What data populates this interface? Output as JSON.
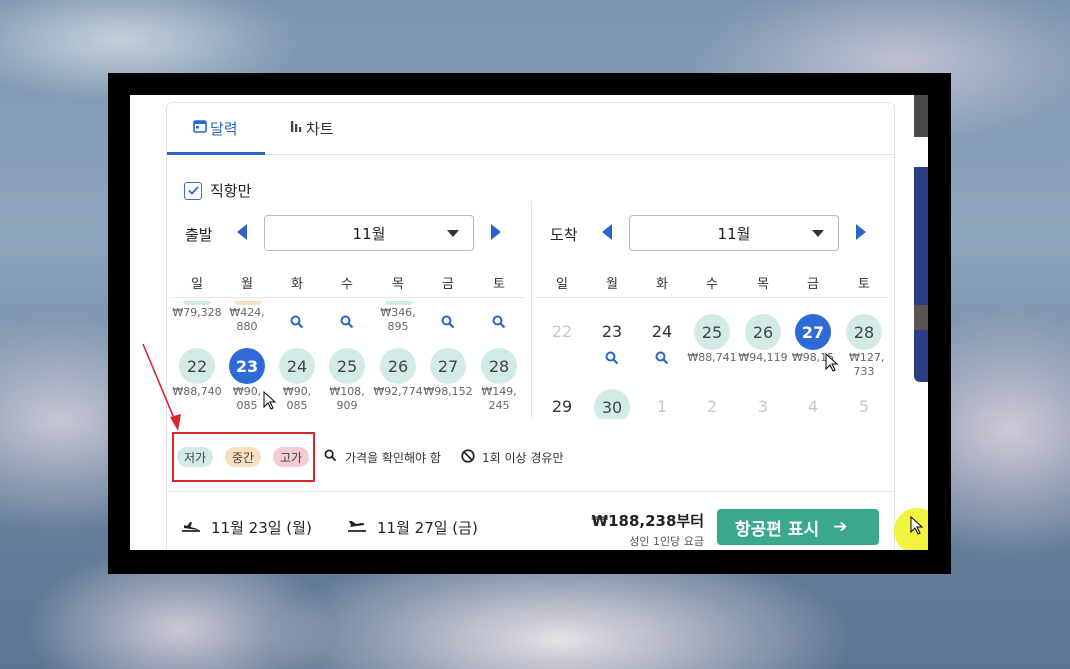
{
  "tabs": {
    "calendar": "달력",
    "chart": "차트"
  },
  "direct_only": "직항만",
  "departure": {
    "label": "출발",
    "month": "11월",
    "weekdays": [
      "일",
      "월",
      "화",
      "수",
      "목",
      "금",
      "토"
    ],
    "row1": [
      {
        "price": "₩79,328"
      },
      {
        "price": "₩424, 880"
      },
      {
        "price": ""
      },
      {
        "price": ""
      },
      {
        "price": "₩346, 895"
      },
      {
        "price": ""
      },
      {
        "price": ""
      }
    ],
    "row2": [
      {
        "day": "22",
        "price": "₩88,740"
      },
      {
        "day": "23",
        "price": "₩90, 085"
      },
      {
        "day": "24",
        "price": "₩90, 085"
      },
      {
        "day": "25",
        "price": "₩108, 909"
      },
      {
        "day": "26",
        "price": "₩92,774"
      },
      {
        "day": "27",
        "price": "₩98,152"
      },
      {
        "day": "28",
        "price": "₩149, 245"
      }
    ]
  },
  "arrival": {
    "label": "도착",
    "month": "11월",
    "weekdays": [
      "일",
      "월",
      "화",
      "수",
      "목",
      "금",
      "토"
    ],
    "row1": [
      {
        "day": "22",
        "price": ""
      },
      {
        "day": "23",
        "price": ""
      },
      {
        "day": "24",
        "price": ""
      },
      {
        "day": "25",
        "price": "₩88,741"
      },
      {
        "day": "26",
        "price": "₩94,119"
      },
      {
        "day": "27",
        "price": "₩98,15"
      },
      {
        "day": "28",
        "price": "₩127, 733"
      }
    ],
    "row2": [
      {
        "day": "29"
      },
      {
        "day": "30"
      },
      {
        "day": "1"
      },
      {
        "day": "2"
      },
      {
        "day": "3"
      },
      {
        "day": "4"
      },
      {
        "day": "5"
      }
    ]
  },
  "legend": {
    "low": "저가",
    "mid": "중간",
    "high": "고가",
    "check_price": "가격을 확인해야 함",
    "one_stop": "1회 이상 경유만"
  },
  "colors": {
    "low": "#d3ebe6",
    "mid": "#f7dfc0",
    "high": "#f2cdd3",
    "accent": "#2a66c9",
    "button": "#3aa88c"
  },
  "summary": {
    "depart_date": "11월 23일 (월)",
    "return_date": "11월 27일 (금)",
    "price": "₩188,238부터",
    "price_note": "성인 1인당 요금",
    "button": "항공편 표시"
  }
}
